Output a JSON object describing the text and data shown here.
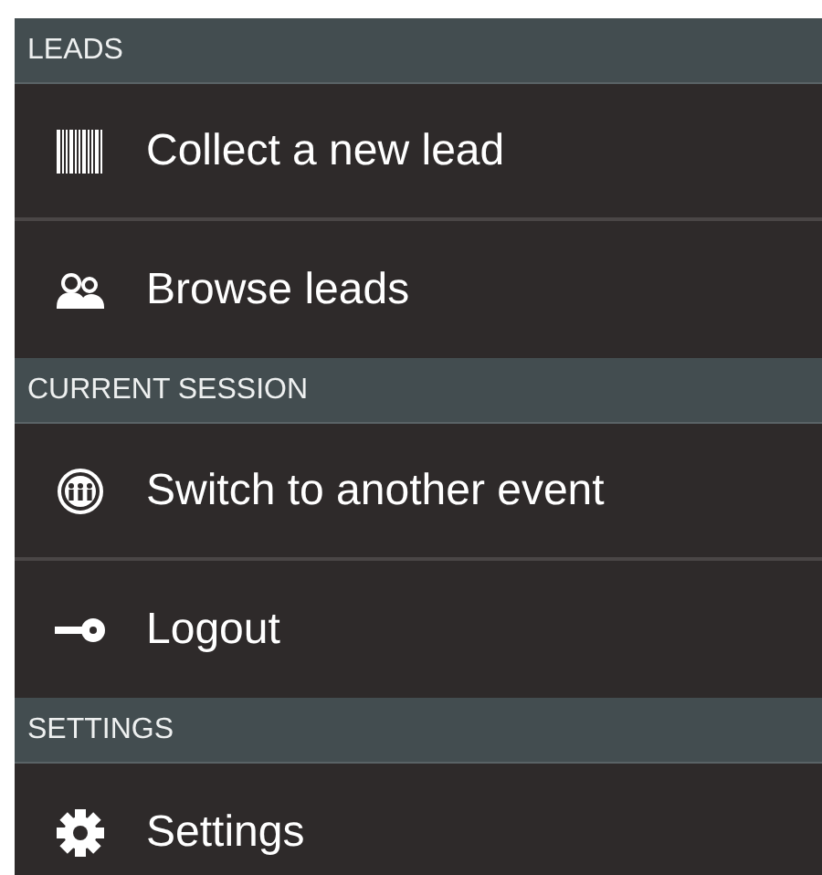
{
  "sections": [
    {
      "header": "LEADS",
      "items": [
        {
          "label": "Collect a new lead",
          "kind": "barcode"
        },
        {
          "label": "Browse leads",
          "kind": "people"
        }
      ]
    },
    {
      "header": "CURRENT SESSION",
      "items": [
        {
          "label": "Switch to another event",
          "kind": "event"
        },
        {
          "label": "Logout",
          "kind": "key"
        }
      ]
    },
    {
      "header": "SETTINGS",
      "items": [
        {
          "label": "Settings",
          "kind": "gear"
        }
      ]
    }
  ]
}
